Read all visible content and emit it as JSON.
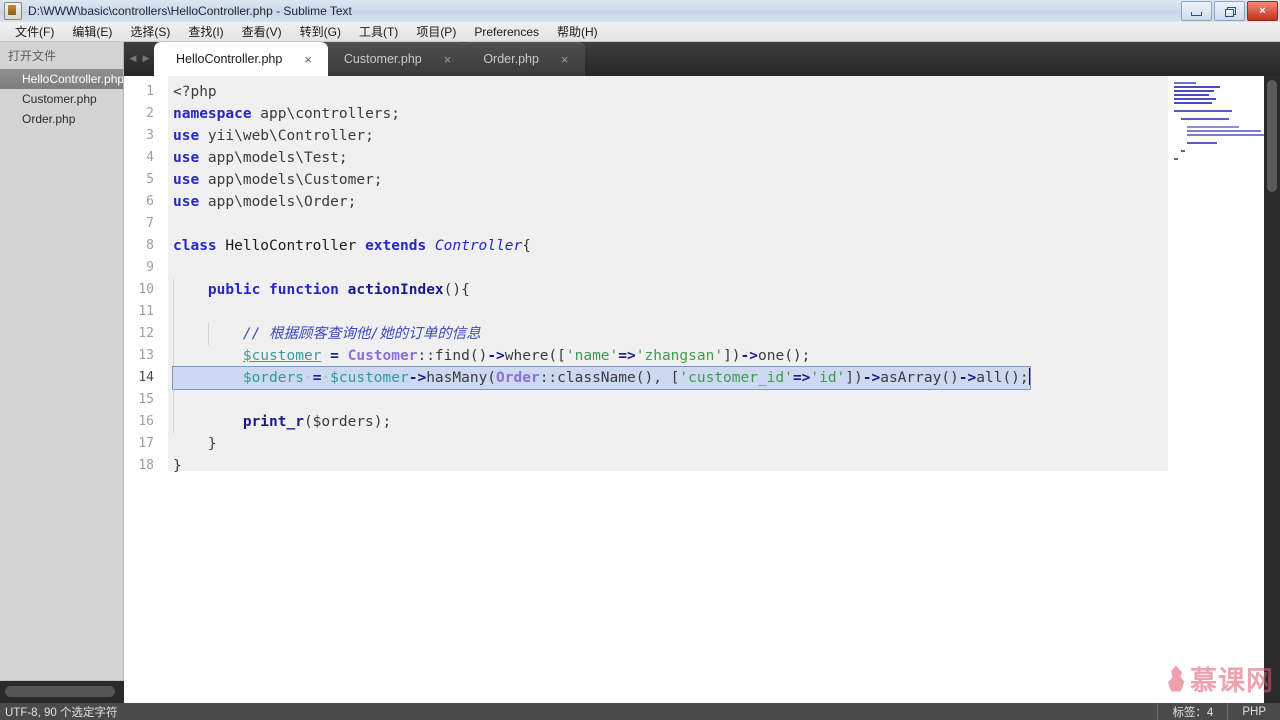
{
  "window": {
    "title": "D:\\WWW\\basic\\controllers\\HelloController.php - Sublime Text",
    "app_icon": "sublime-text-icon",
    "buttons": {
      "minimize": "minimize-icon",
      "maximize": "maximize-icon",
      "close": "×"
    }
  },
  "menubar": {
    "items": [
      {
        "label": "文件(F)"
      },
      {
        "label": "编辑(E)"
      },
      {
        "label": "选择(S)"
      },
      {
        "label": "查找(I)"
      },
      {
        "label": "查看(V)"
      },
      {
        "label": "转到(G)"
      },
      {
        "label": "工具(T)"
      },
      {
        "label": "项目(P)"
      },
      {
        "label": "Preferences"
      },
      {
        "label": "帮助(H)"
      }
    ]
  },
  "sidebar": {
    "header": "打开文件",
    "files": [
      {
        "label": "HelloController.php",
        "active": true
      },
      {
        "label": "Customer.php",
        "active": false
      },
      {
        "label": "Order.php",
        "active": false
      }
    ]
  },
  "tabbar": {
    "nav_prev": "◀",
    "nav_next": "▶",
    "close_glyph": "×",
    "tabs": [
      {
        "label": "HelloController.php",
        "active": true
      },
      {
        "label": "Customer.php",
        "active": false
      },
      {
        "label": "Order.php",
        "active": false
      }
    ]
  },
  "editor": {
    "selected_line": 14,
    "line_numbers": [
      "1",
      "2",
      "3",
      "4",
      "5",
      "6",
      "7",
      "8",
      "9",
      "10",
      "11",
      "12",
      "13",
      "14",
      "15",
      "16",
      "17",
      "18"
    ],
    "lines": [
      {
        "n": "1",
        "text": "<?php"
      },
      {
        "n": "2",
        "text": "namespace app\\controllers;"
      },
      {
        "n": "3",
        "text": "use yii\\web\\Controller;"
      },
      {
        "n": "4",
        "text": "use app\\models\\Test;"
      },
      {
        "n": "5",
        "text": "use app\\models\\Customer;"
      },
      {
        "n": "6",
        "text": "use app\\models\\Order;"
      },
      {
        "n": "7",
        "text": ""
      },
      {
        "n": "8",
        "text": "class HelloController extends Controller{"
      },
      {
        "n": "9",
        "text": ""
      },
      {
        "n": "10",
        "text": "    public function actionIndex(){"
      },
      {
        "n": "11",
        "text": ""
      },
      {
        "n": "12",
        "text": "        // 根据顾客查询他/她的订单的信息"
      },
      {
        "n": "13",
        "text": "        $customer = Customer::find()->where(['name'=>'zhangsan'])->one();"
      },
      {
        "n": "14",
        "text": "        $orders = $customer->hasMany(Order::className(), ['customer_id'=>'id'])->asArray()->all();"
      },
      {
        "n": "15",
        "text": ""
      },
      {
        "n": "16",
        "text": "        print_r($orders);"
      },
      {
        "n": "17",
        "text": "    }"
      },
      {
        "n": "18",
        "text": "}"
      }
    ],
    "tokens": {
      "php_open": "<?php",
      "namespace_kw": "namespace",
      "namespace_val": " app\\controllers;",
      "use_kw": "use",
      "use1": " yii\\web\\Controller;",
      "use2": " app\\models\\Test;",
      "use3": " app\\models\\Customer;",
      "use4": " app\\models\\Order;",
      "class_kw": "class",
      "class_name": " HelloController ",
      "extends_kw": "extends",
      "parent_cls": "Controller",
      "brace_open": "{",
      "public_kw": "public",
      "function_kw": "function",
      "method_name": "actionIndex",
      "method_parens": "(){",
      "comment": "// 根据顾客查询他/她的订单的信息",
      "v_customer": "$customer",
      "eq": "=",
      "cls_customer": "Customer",
      "find_call": "::find()",
      "arrow": "->",
      "where_call": "where([",
      "str_name": "'name'",
      "fat_arrow": "=>",
      "str_zhangsan": "'zhangsan'",
      "close_where": "])",
      "one_call": "one();",
      "v_orders": "$orders",
      "hasmany_call": "hasMany(",
      "cls_order": "Order",
      "classname_call": "::className(), [",
      "str_customer_id": "'customer_id'",
      "str_id": "'id'",
      "close_hasmany": "])",
      "asarray_call": "asArray()",
      "all_call": "all();",
      "print_r": "print_r",
      "print_r_args": "($orders);",
      "brace_close_inner": "}",
      "brace_close_outer": "}"
    }
  },
  "statusbar": {
    "left": "UTF-8, 90 个选定字符",
    "tab_size": "标签：4",
    "syntax": "PHP"
  },
  "watermark": {
    "text": "慕课网",
    "icon": "flame-icon"
  },
  "colors": {
    "keyword": "#2727c6",
    "string": "#3f9c4f",
    "variable": "#2a9d9d",
    "class_type": "#8a70d6",
    "comment": "#3a49c4",
    "selection": "#ccd9f0",
    "accent_close": "#c6311c",
    "watermark": "#e05a72"
  }
}
